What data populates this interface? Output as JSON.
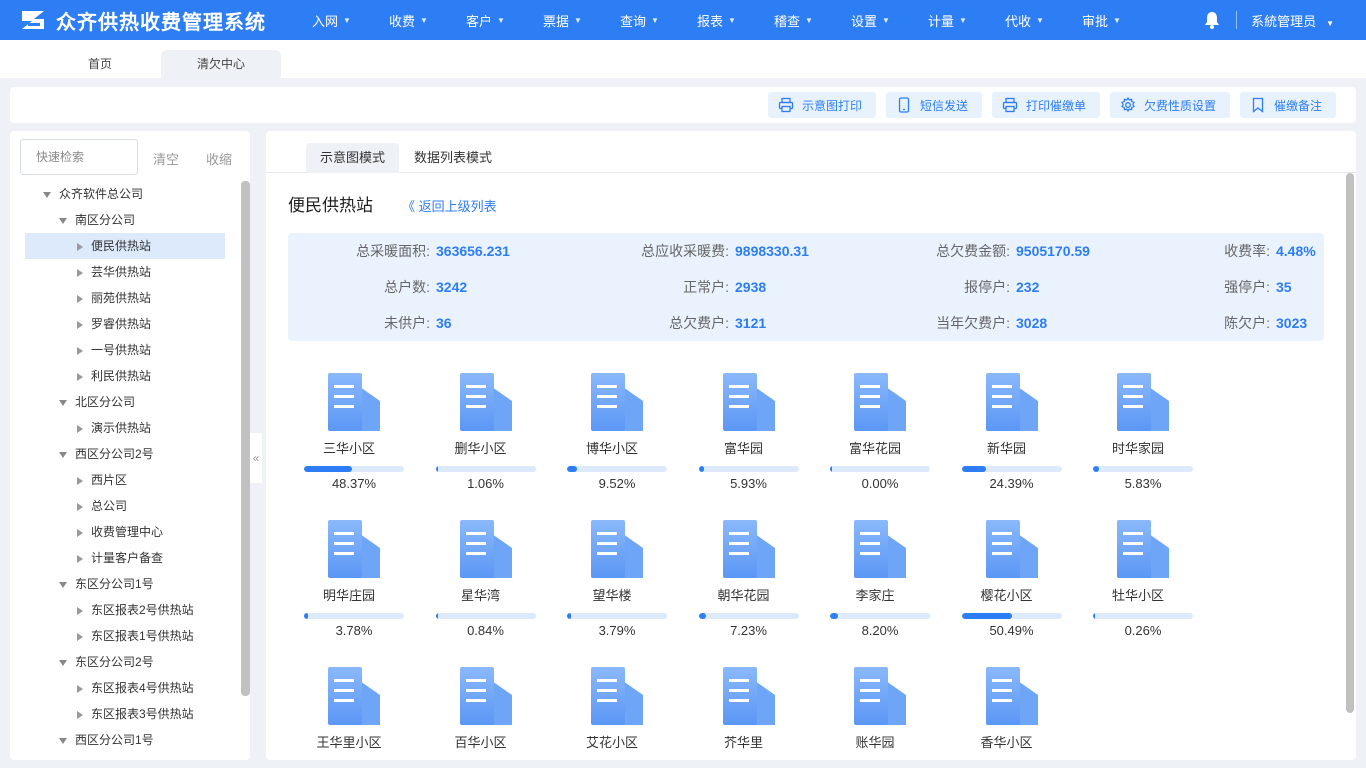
{
  "app": {
    "title": "众齐供热收费管理系统"
  },
  "nav": [
    "入网",
    "收费",
    "客户",
    "票据",
    "查询",
    "报表",
    "稽查",
    "设置",
    "计量",
    "代收",
    "审批"
  ],
  "user": {
    "name": "系統管理员"
  },
  "page_tabs": [
    "首页",
    "清欠中心"
  ],
  "toolbar": {
    "buttons": [
      {
        "label": "示意图打印",
        "icon": "printer-icon"
      },
      {
        "label": "短信发送",
        "icon": "phone-icon"
      },
      {
        "label": "打印催缴单",
        "icon": "printer-icon"
      },
      {
        "label": "欠费性质设置",
        "icon": "gear-icon"
      },
      {
        "label": "催缴备注",
        "icon": "bookmark-icon"
      }
    ]
  },
  "sidebar": {
    "search_placeholder": "快速检索",
    "clear_label": "清空",
    "collapse_label": "收缩",
    "tree": [
      {
        "label": "众齐软件总公司",
        "level": 0,
        "expanded": true
      },
      {
        "label": "南区分公司",
        "level": 1,
        "expanded": true
      },
      {
        "label": "便民供热站",
        "level": 2,
        "selected": true
      },
      {
        "label": "芸华供热站",
        "level": 2
      },
      {
        "label": "丽苑供热站",
        "level": 2
      },
      {
        "label": "罗睿供热站",
        "level": 2
      },
      {
        "label": "一号供热站",
        "level": 2
      },
      {
        "label": "利民供热站",
        "level": 2
      },
      {
        "label": "北区分公司",
        "level": 1,
        "expanded": true
      },
      {
        "label": "演示供热站",
        "level": 2
      },
      {
        "label": "西区分公司2号",
        "level": 1,
        "expanded": true
      },
      {
        "label": "西片区",
        "level": 2
      },
      {
        "label": "总公司",
        "level": 2
      },
      {
        "label": "收费管理中心",
        "level": 2
      },
      {
        "label": "计量客户备查",
        "level": 2
      },
      {
        "label": "东区分公司1号",
        "level": 1,
        "expanded": true
      },
      {
        "label": "东区报表2号供热站",
        "level": 2
      },
      {
        "label": "东区报表1号供热站",
        "level": 2
      },
      {
        "label": "东区分公司2号",
        "level": 1,
        "expanded": true
      },
      {
        "label": "东区报表4号供热站",
        "level": 2
      },
      {
        "label": "东区报表3号供热站",
        "level": 2
      },
      {
        "label": "西区分公司1号",
        "level": 1,
        "expanded": true
      }
    ]
  },
  "main": {
    "mode_tabs": [
      "示意图模式",
      "数据列表模式"
    ],
    "station_title": "便民供热站",
    "back_link": "《 返回上级列表",
    "stats": [
      {
        "label": "总采暖面积:",
        "value": "363656.231"
      },
      {
        "label": "总应收采暖费:",
        "value": "9898330.31"
      },
      {
        "label": "总欠费金额:",
        "value": "9505170.59"
      },
      {
        "label": "收费率:",
        "value": "4.48%"
      },
      {
        "label": "总户数:",
        "value": "3242"
      },
      {
        "label": "正常户:",
        "value": "2938"
      },
      {
        "label": "报停户:",
        "value": "232"
      },
      {
        "label": "强停户:",
        "value": "35"
      },
      {
        "label": "未供户:",
        "value": "36"
      },
      {
        "label": "总欠费户:",
        "value": "3121"
      },
      {
        "label": "当年欠费户:",
        "value": "3028"
      },
      {
        "label": "陈欠户:",
        "value": "3023"
      }
    ],
    "communities": [
      {
        "name": "三华小区",
        "pct": "48.37%",
        "ratio": 0.4837
      },
      {
        "name": "删华小区",
        "pct": "1.06%",
        "ratio": 0.0106
      },
      {
        "name": "博华小区",
        "pct": "9.52%",
        "ratio": 0.0952
      },
      {
        "name": "富华园",
        "pct": "5.93%",
        "ratio": 0.0593
      },
      {
        "name": "富华花园",
        "pct": "0.00%",
        "ratio": 0
      },
      {
        "name": "新华园",
        "pct": "24.39%",
        "ratio": 0.2439
      },
      {
        "name": "时华家园",
        "pct": "5.83%",
        "ratio": 0.0583
      },
      {
        "name": "明华庄园",
        "pct": "3.78%",
        "ratio": 0.0378
      },
      {
        "name": "星华湾",
        "pct": "0.84%",
        "ratio": 0.0084
      },
      {
        "name": "望华楼",
        "pct": "3.79%",
        "ratio": 0.0379
      },
      {
        "name": "朝华花园",
        "pct": "7.23%",
        "ratio": 0.0723
      },
      {
        "name": "李家庄",
        "pct": "8.20%",
        "ratio": 0.082
      },
      {
        "name": "樱花小区",
        "pct": "50.49%",
        "ratio": 0.5049
      },
      {
        "name": "牡华小区",
        "pct": "0.26%",
        "ratio": 0.0026
      },
      {
        "name": "王华里小区",
        "pct": "",
        "ratio": null
      },
      {
        "name": "百华小区",
        "pct": "",
        "ratio": null
      },
      {
        "name": "艾花小区",
        "pct": "",
        "ratio": null
      },
      {
        "name": "芥华里",
        "pct": "",
        "ratio": null
      },
      {
        "name": "账华园",
        "pct": "",
        "ratio": null
      },
      {
        "name": "香华小区",
        "pct": "",
        "ratio": null
      }
    ]
  },
  "colors": {
    "primary": "#2d7df4",
    "stats_bg": "#eaf3fd",
    "progress_track": "#dceafc"
  }
}
